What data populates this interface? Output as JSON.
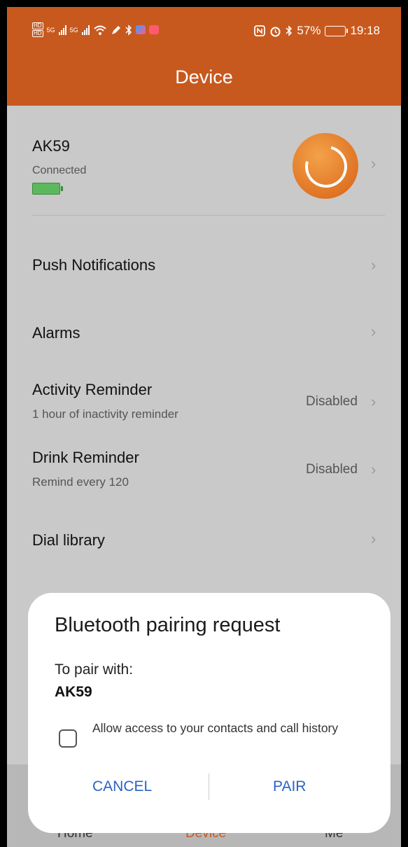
{
  "status_bar": {
    "left_badge_top": "HD",
    "left_badge_bottom": "HD",
    "sim1": "5G",
    "sim2": "5G",
    "battery_percent": "57%",
    "time": "19:18"
  },
  "header": {
    "title": "Device"
  },
  "device": {
    "name": "AK59",
    "status": "Connected",
    "battery_color": "#5cb85c"
  },
  "menu": {
    "push_notifications": "Push Notifications",
    "alarms": "Alarms",
    "activity_reminder": {
      "label": "Activity Reminder",
      "sub": "1 hour of inactivity reminder",
      "value": "Disabled"
    },
    "drink_reminder": {
      "label": "Drink Reminder",
      "sub": "Remind every 120",
      "value": "Disabled"
    },
    "dial_library": "Dial library"
  },
  "nav": {
    "home": "Home",
    "device": "Device",
    "me": "Me"
  },
  "dialog": {
    "title": "Bluetooth pairing request",
    "line": "To pair with:",
    "device": "AK59",
    "checkbox_label": "Allow access to your contacts and call history",
    "cancel": "CANCEL",
    "pair": "PAIR"
  },
  "colors": {
    "accent": "#c8591e",
    "dialog_button": "#2a63c6",
    "overlay": "#c9c9c9"
  }
}
